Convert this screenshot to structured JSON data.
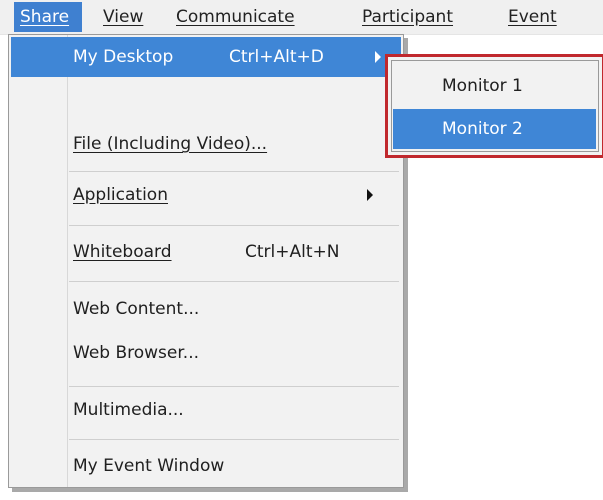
{
  "menubar": {
    "items": [
      {
        "label": "Share",
        "active": true
      },
      {
        "label": "View"
      },
      {
        "label": "Communicate"
      },
      {
        "label": "Participant"
      },
      {
        "label": "Event"
      }
    ]
  },
  "share_menu": {
    "items": [
      {
        "label": "My Desktop",
        "shortcut": "Ctrl+Alt+D",
        "submenu": true,
        "highlighted": true
      },
      {
        "label": "File (Including Video)..."
      },
      {
        "label": "Application",
        "submenu": true
      },
      {
        "label": "Whiteboard",
        "shortcut": "Ctrl+Alt+N"
      },
      {
        "label": "Web Content..."
      },
      {
        "label": "Web Browser..."
      },
      {
        "label": "Multimedia..."
      },
      {
        "label": "My Event Window"
      }
    ]
  },
  "monitor_submenu": {
    "items": [
      {
        "label": "Monitor 1"
      },
      {
        "label": "Monitor 2",
        "highlighted": true
      }
    ],
    "highlight_color": "#c0282d"
  },
  "colors": {
    "selection": "#3f86d6",
    "menu_background": "#f2f2f2",
    "callout_border": "#c0282d"
  }
}
